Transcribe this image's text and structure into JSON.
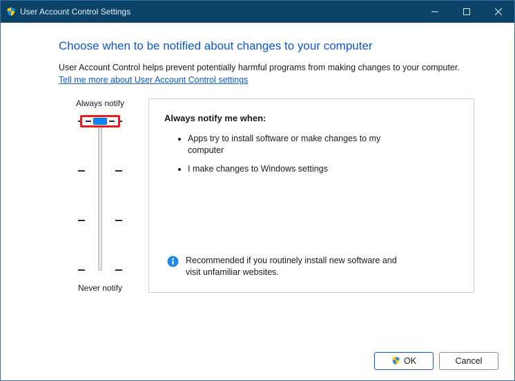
{
  "window": {
    "title": "User Account Control Settings"
  },
  "content": {
    "heading": "Choose when to be notified about changes to your computer",
    "description": "User Account Control helps prevent potentially harmful programs from making changes to your computer.",
    "link": "Tell me more about User Account Control settings"
  },
  "slider": {
    "top_label": "Always notify",
    "bottom_label": "Never notify",
    "levels": 4,
    "current_level": 3
  },
  "panel": {
    "title": "Always notify me when:",
    "bullets": [
      "Apps try to install software or make changes to my computer",
      "I make changes to Windows settings"
    ],
    "recommendation": "Recommended if you routinely install new software and visit unfamiliar websites."
  },
  "buttons": {
    "ok": "OK",
    "cancel": "Cancel"
  }
}
